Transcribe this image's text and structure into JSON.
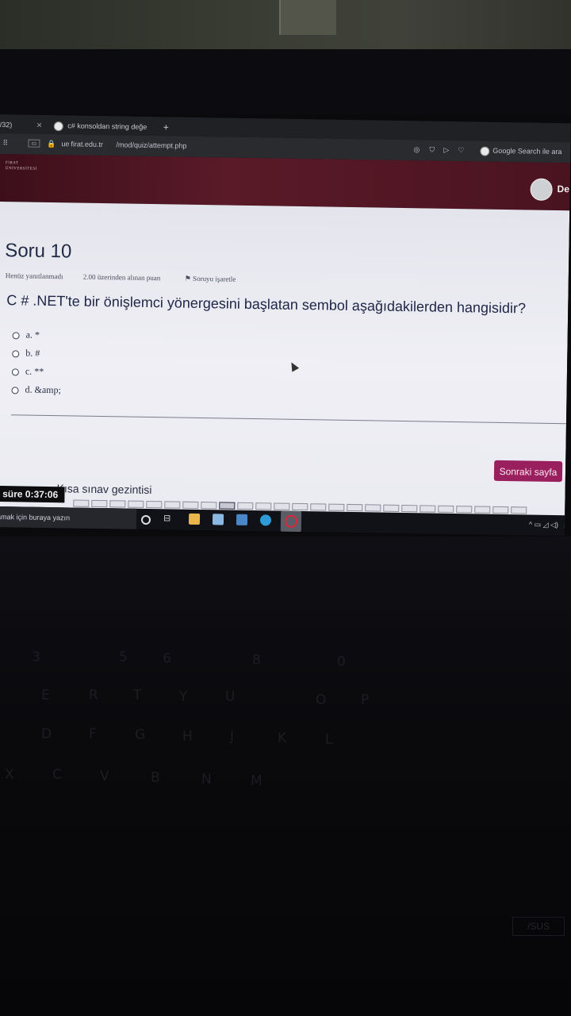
{
  "browser": {
    "tabs": [
      {
        "label": "/32)",
        "close": "✕"
      },
      {
        "label": "c# konsoldan string değe",
        "close": "✕"
      }
    ],
    "new_tab": "+",
    "address": {
      "prefix": "ue",
      "domain": "firat.edu.tr",
      "path": "/mod/quiz/attempt.php"
    },
    "search_engine_label": "Google Search ile ara"
  },
  "site": {
    "logo_line1": "FIRAT",
    "logo_line2": "ÜNİVERSİTESİ",
    "user_short": "De"
  },
  "quiz": {
    "title": "Soru 10",
    "status": "Henüz yanıtlanmadı",
    "points": "2.00 üzerinden alınan puan",
    "flag": "Soruyu işaretle",
    "question": "C # .NET'te bir önişlemci yönergesini başlatan sembol aşağıdakilerden hangisidir?",
    "options": [
      "a. *",
      "b. #",
      "c. **",
      "d. &amp;"
    ],
    "next_button": "Sonraki sayfa",
    "nav_title": "Kısa sınav gezintisi",
    "timer_prefix": "n süre",
    "timer_value": "0:37:06"
  },
  "taskbar": {
    "search_placeholder": "amak için buraya yazın"
  }
}
